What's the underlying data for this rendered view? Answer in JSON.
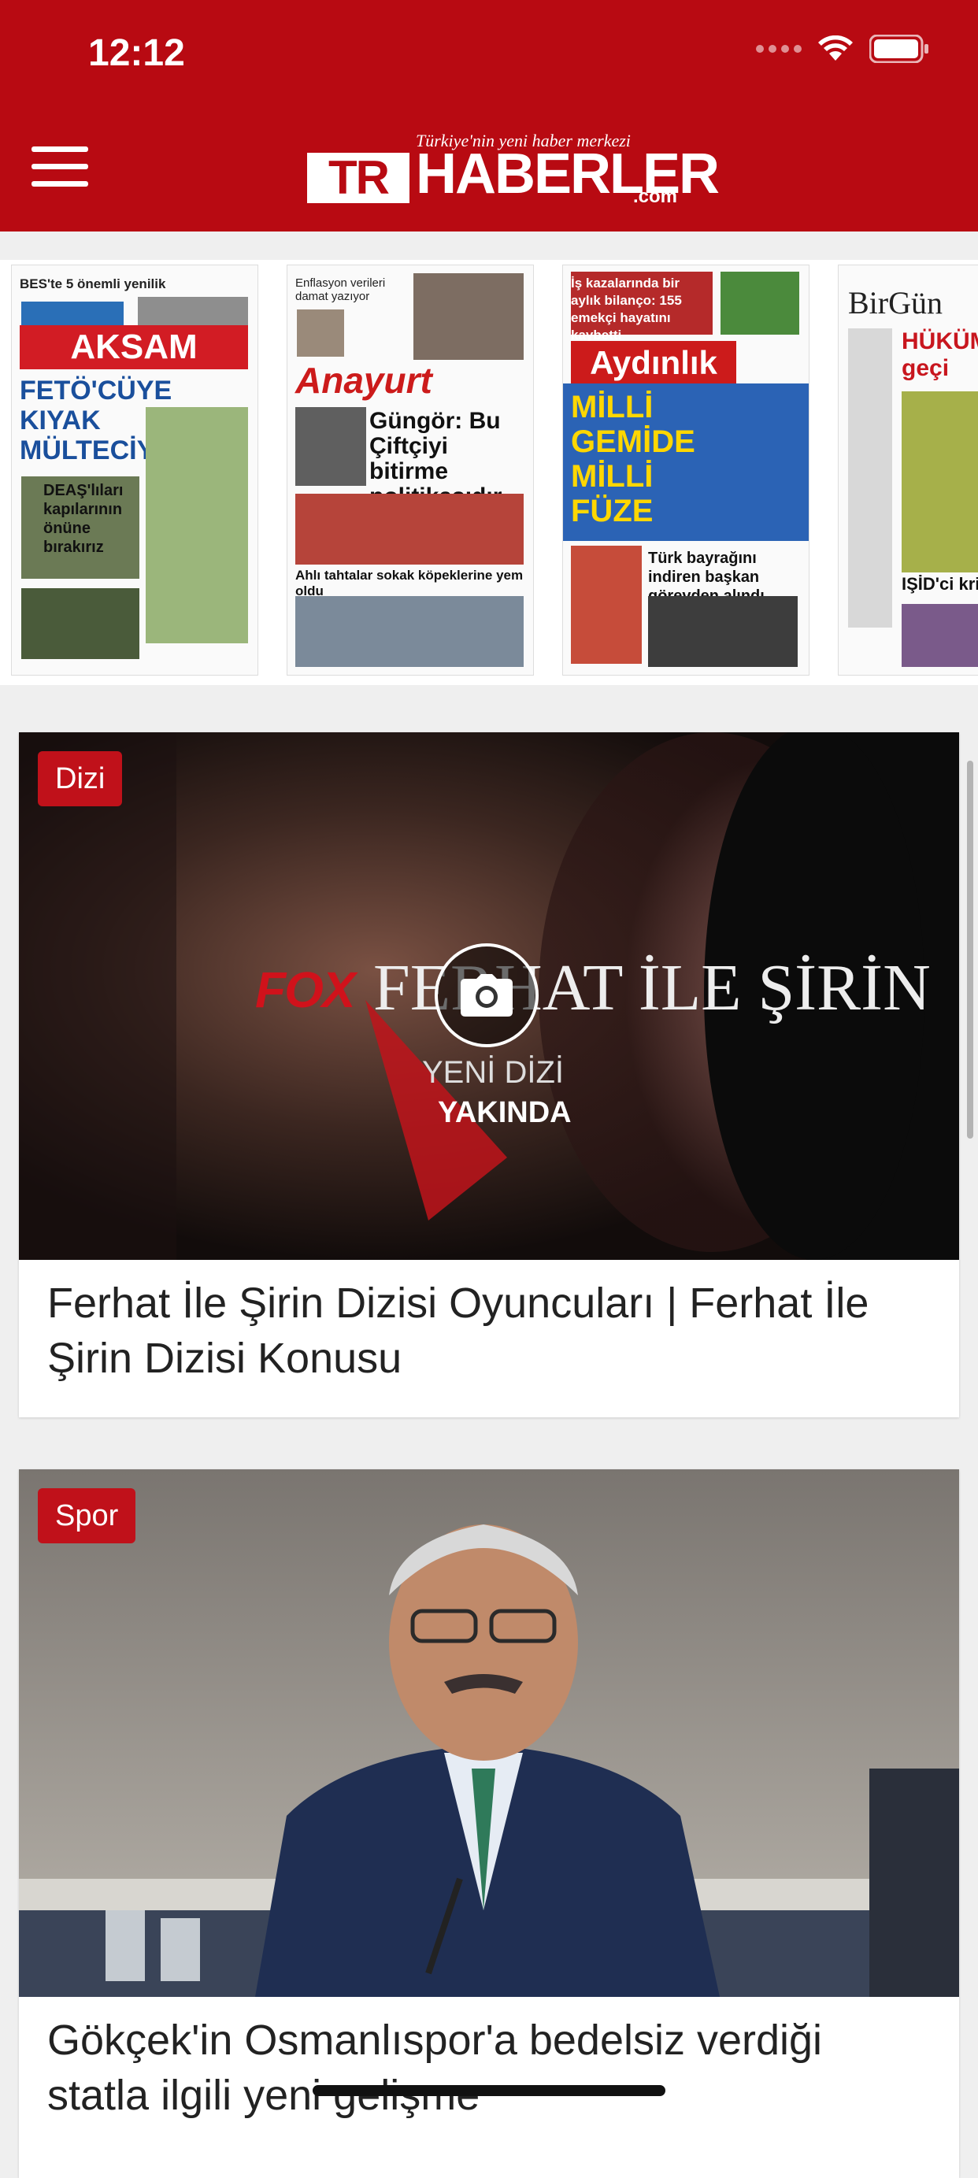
{
  "status_bar": {
    "time": "12:12"
  },
  "header": {
    "logo_tr": "TR",
    "logo_name": "HABERLER",
    "logo_tagline": "Türkiye'nin yeni haber merkezi",
    "logo_domain": ".com",
    "menu_icon": "hamburger-menu-icon",
    "accent_color": "#b80a12"
  },
  "newspapers": [
    {
      "masthead": "AKSAM",
      "topline": "BES'te 5 önemli yenilik",
      "headline": "FETÖ'CÜYE KIYAK MÜLTECİYE DAYAK",
      "subhead": "DEAŞ'lıları kapılarının önüne bırakırız"
    },
    {
      "masthead": "Anayurt",
      "topline": "Enflasyon verileri damat yazıyor",
      "headline": "Güngör: Bu Çiftçiyi bitirme politikasıdır",
      "subhead": "Ahlı tahtalar sokak köpeklerine yem oldu"
    },
    {
      "masthead": "Aydınlık",
      "topline": "İş kazalarında bir aylık bilanço: 155 emekçi hayatını kaybetti",
      "headline": "MİLLİ GEMİDE MİLLİ FÜZE",
      "subhead": "Türk bayrağını indiren başkan görevden alındı"
    },
    {
      "masthead": "BirGün",
      "topline": "",
      "headline": "HÜKÜMET halk geçi",
      "subhead": "IŞİD'ci krizi tırm"
    }
  ],
  "cards": [
    {
      "category": "Dizi",
      "title": "Ferhat İle Şirin Dizisi Oyuncuları | Ferhat İle Şirin Dizisi Konusu",
      "image_overlay": {
        "network": "FOX",
        "show": "FERHAT İLE ŞİRİN",
        "line1": "YENİ DİZİ",
        "line2": "YAKINDA"
      },
      "gallery_icon": "camera-icon"
    },
    {
      "category": "Spor",
      "title": "Gökçek'in Osmanlıspor'a bedelsiz verdiği statla ilgili yeni gelişme"
    }
  ]
}
